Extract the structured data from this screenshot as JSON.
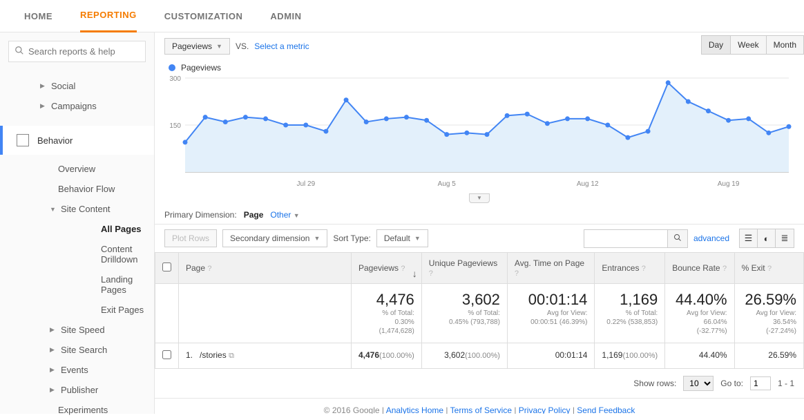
{
  "topnav": {
    "home": "HOME",
    "reporting": "REPORTING",
    "customization": "CUSTOMIZATION",
    "admin": "ADMIN"
  },
  "search": {
    "placeholder": "Search reports & help"
  },
  "sidebar": {
    "social": "Social",
    "campaigns": "Campaigns",
    "behavior": "Behavior",
    "overview": "Overview",
    "behavior_flow": "Behavior Flow",
    "site_content": "Site Content",
    "all_pages": "All Pages",
    "content_drilldown": "Content Drilldown",
    "landing_pages": "Landing Pages",
    "exit_pages": "Exit Pages",
    "site_speed": "Site Speed",
    "site_search": "Site Search",
    "events": "Events",
    "publisher": "Publisher",
    "experiments": "Experiments"
  },
  "metric_bar": {
    "metric": "Pageviews",
    "vs": "VS.",
    "select": "Select a metric"
  },
  "period": {
    "day": "Day",
    "week": "Week",
    "month": "Month"
  },
  "legend": {
    "label": "Pageviews"
  },
  "chart_data": {
    "type": "line",
    "title": "",
    "xlabel": "",
    "ylabel": "",
    "ylim": [
      0,
      300
    ],
    "yticks": [
      150,
      300
    ],
    "xticks": [
      "Jul 29",
      "Aug 5",
      "Aug 12",
      "Aug 19"
    ],
    "xtick_positions": [
      6,
      13,
      20,
      27
    ],
    "x": [
      0,
      1,
      2,
      3,
      4,
      5,
      6,
      7,
      8,
      9,
      10,
      11,
      12,
      13,
      14,
      15,
      16,
      17,
      18,
      19,
      20,
      21,
      22,
      23,
      24,
      25,
      26,
      27,
      28,
      29,
      30
    ],
    "values": [
      95,
      175,
      160,
      175,
      170,
      150,
      150,
      130,
      230,
      160,
      170,
      175,
      165,
      120,
      125,
      120,
      180,
      185,
      155,
      170,
      170,
      150,
      110,
      130,
      285,
      225,
      195,
      165,
      170,
      125,
      145
    ]
  },
  "primary_dim": {
    "label": "Primary Dimension:",
    "selected": "Page",
    "other": "Other"
  },
  "toolbar": {
    "plot_rows": "Plot Rows",
    "secondary": "Secondary dimension",
    "sort_type": "Sort Type:",
    "default": "Default",
    "advanced": "advanced"
  },
  "table": {
    "headers": {
      "page": "Page",
      "pageviews": "Pageviews",
      "unique": "Unique Pageviews",
      "avg_time": "Avg. Time on Page",
      "entrances": "Entrances",
      "bounce": "Bounce Rate",
      "exit": "% Exit"
    },
    "totals": {
      "pageviews": {
        "big": "4,476",
        "l1": "% of Total:",
        "l2": "0.30%",
        "l3": "(1,474,628)"
      },
      "unique": {
        "big": "3,602",
        "l1": "% of Total:",
        "l2": "0.45% (793,788)"
      },
      "avg_time": {
        "big": "00:01:14",
        "l1": "Avg for View:",
        "l2": "00:00:51 (46.39%)"
      },
      "entrances": {
        "big": "1,169",
        "l1": "% of Total:",
        "l2": "0.22% (538,853)"
      },
      "bounce": {
        "big": "44.40%",
        "l1": "Avg for View:",
        "l2": "66.04% (-32.77%)"
      },
      "exit": {
        "big": "26.59%",
        "l1": "Avg for View:",
        "l2": "36.54% (-27.24%)"
      }
    },
    "rows": [
      {
        "idx": "1.",
        "page": "/stories",
        "pageviews": "4,476",
        "pageviews_pct": "(100.00%)",
        "unique": "3,602",
        "unique_pct": "(100.00%)",
        "avg_time": "00:01:14",
        "entrances": "1,169",
        "entrances_pct": "(100.00%)",
        "bounce": "44.40%",
        "exit": "26.59%"
      }
    ]
  },
  "pager": {
    "show_rows": "Show rows:",
    "rows_value": "10",
    "goto": "Go to:",
    "goto_value": "1",
    "range": "1 - 1"
  },
  "footer": {
    "copyright": "© 2016 Google",
    "home": "Analytics Home",
    "tos": "Terms of Service",
    "privacy": "Privacy Policy",
    "feedback": "Send Feedback"
  }
}
